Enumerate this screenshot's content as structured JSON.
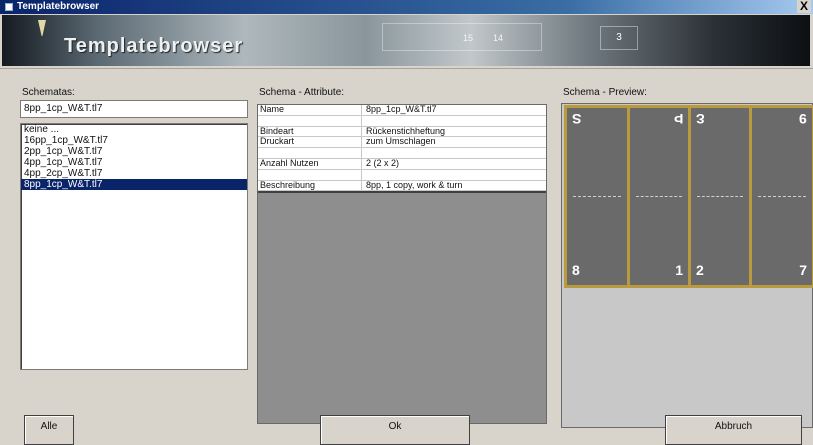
{
  "window": {
    "title": "Templatebrowser",
    "close_glyph": "X"
  },
  "banner": {
    "title": "Templatebrowser",
    "strip_left": "15",
    "strip_right": "14",
    "page_number": "3"
  },
  "schematas": {
    "label": "Schematas:",
    "current_value": "8pp_1cp_W&T.tl7",
    "items": [
      "keine ...",
      "16pp_1cp_W&T.tl7",
      "2pp_1cp_W&T.tl7",
      "4pp_1cp_W&T.tl7",
      "4pp_2cp_W&T.tl7",
      "8pp_1cp_W&T.tl7"
    ],
    "selected_index": 5
  },
  "attributes": {
    "label": "Schema - Attribute:",
    "rows": [
      {
        "key": "Name",
        "value": "8pp_1cp_W&T.tl7"
      },
      {
        "key": "",
        "value": ""
      },
      {
        "key": "Bindeart",
        "value": "Rückenstichheftung"
      },
      {
        "key": "Druckart",
        "value": "zum Umschlagen"
      },
      {
        "key": "",
        "value": ""
      },
      {
        "key": "Anzahl Nutzen",
        "value": "2 (2 x 2)"
      },
      {
        "key": "",
        "value": ""
      },
      {
        "key": "Beschreibung",
        "value": "8pp, 1 copy, work & turn"
      }
    ]
  },
  "preview": {
    "label": "Schema - Preview:",
    "top_numbers": [
      "S",
      "Þ",
      "Ɛ",
      "9"
    ],
    "bottom_numbers": [
      "8",
      "1",
      "2",
      "7"
    ]
  },
  "buttons": {
    "all": "Alle",
    "ok": "Ok",
    "cancel": "Abbruch"
  },
  "colors": {
    "selection": "#0a246a",
    "sheet_border": "#b99a3d",
    "page_fill": "#6a6a6a"
  }
}
